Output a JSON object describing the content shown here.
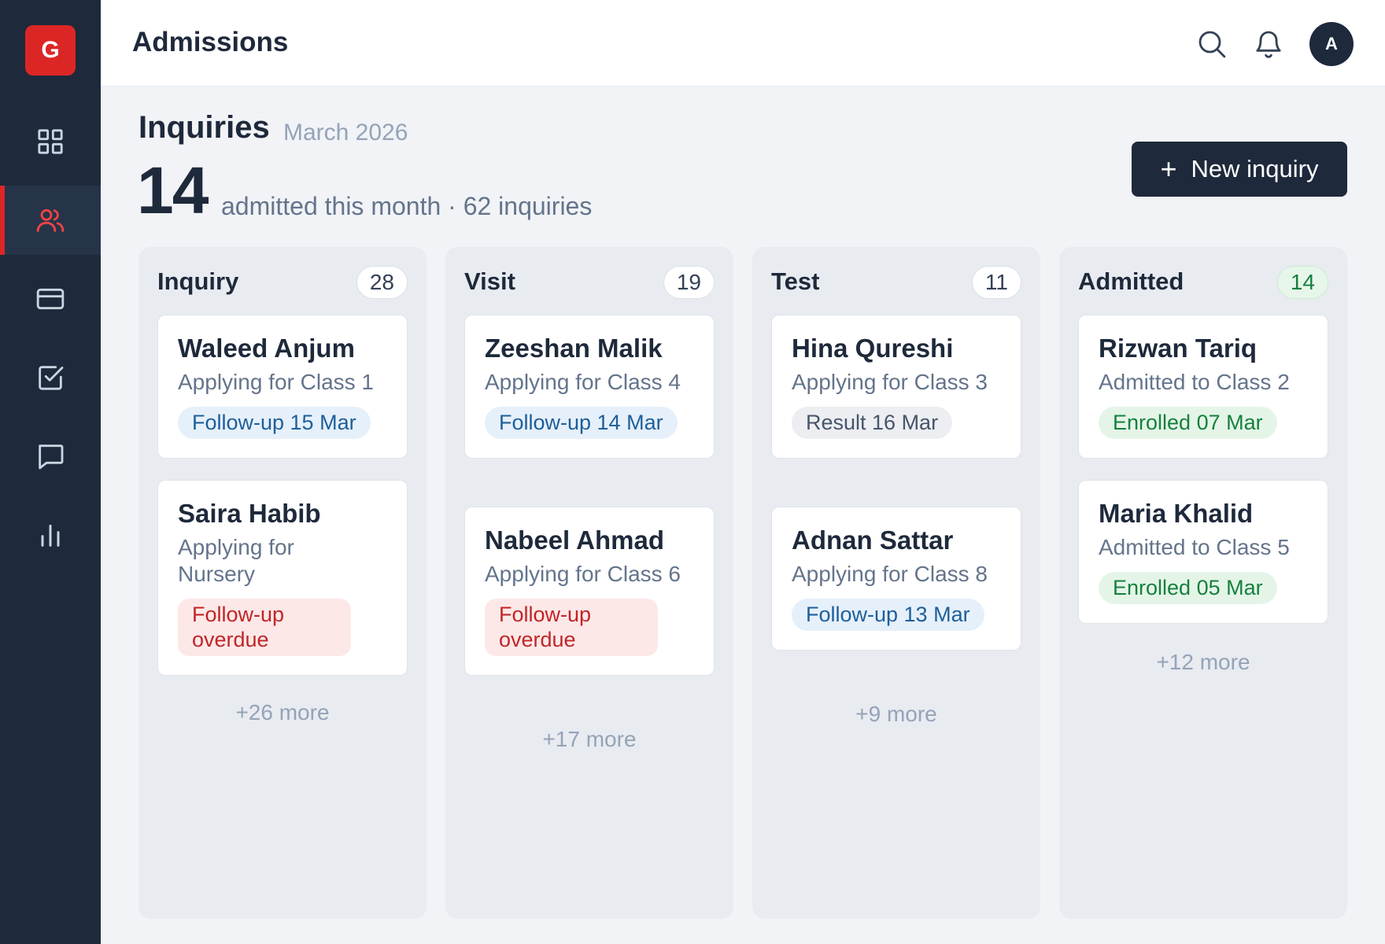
{
  "app": {
    "logo_letter": "G"
  },
  "sidebar": {
    "items": [
      {
        "icon": "grid-icon",
        "label": "Dashboard"
      },
      {
        "icon": "users-icon",
        "label": "Admissions",
        "active": true
      },
      {
        "icon": "card-icon",
        "label": "Fees"
      },
      {
        "icon": "checkbox-icon",
        "label": "Attendance"
      },
      {
        "icon": "chat-icon",
        "label": "Messages"
      },
      {
        "icon": "bar-chart-icon",
        "label": "Reports"
      }
    ]
  },
  "header": {
    "title": "Admissions",
    "avatar_initial": "A"
  },
  "page": {
    "title": "Inquiries",
    "subtitle": "March 2026",
    "admitted_count": "14",
    "summary": "admitted this month · 62 inquiries",
    "new_button": {
      "icon": "+",
      "label": "New inquiry"
    }
  },
  "columns": [
    {
      "title": "Inquiry",
      "count": "28",
      "cards": [
        {
          "name": "Waleed Anjum",
          "desc": "Applying for Class 1",
          "badge": "Follow-up 15 Mar",
          "badge_type": "blue"
        },
        {
          "name": "Saira Habib",
          "desc": "Applying for Nursery",
          "badge": "Follow-up overdue",
          "badge_type": "red"
        }
      ],
      "more": "+26 more"
    },
    {
      "title": "Visit",
      "count": "19",
      "cards": [
        {
          "name": "Zeeshan Malik",
          "desc": "Applying for Class 4",
          "badge": "Follow-up 14 Mar",
          "badge_type": "blue"
        },
        {
          "name": "Nabeel Ahmad",
          "desc": "Applying for Class 6",
          "badge": "Follow-up overdue",
          "badge_type": "red"
        }
      ],
      "more": "+17 more"
    },
    {
      "title": "Test",
      "count": "11",
      "cards": [
        {
          "name": "Hina Qureshi",
          "desc": "Applying for Class 3",
          "badge": "Result 16 Mar",
          "badge_type": "gray"
        },
        {
          "name": "Adnan Sattar",
          "desc": "Applying for Class 8",
          "badge": "Follow-up 13 Mar",
          "badge_type": "blue"
        }
      ],
      "more": "+9 more"
    },
    {
      "title": "Admitted",
      "count": "14",
      "cards": [
        {
          "name": "Rizwan Tariq",
          "desc": "Admitted to Class 2",
          "badge": "Enrolled 07 Mar",
          "badge_type": "green"
        },
        {
          "name": "Maria Khalid",
          "desc": "Admitted to Class 5",
          "badge": "Enrolled 05 Mar",
          "badge_type": "green"
        }
      ],
      "more": "+12 more"
    }
  ],
  "colors": {
    "sidebar_bg": "#1e293b",
    "accent": "#dc2626",
    "primary_button": "#1e293b",
    "badge_blue": "#1d5f9a",
    "badge_red": "#c02626",
    "badge_green": "#16803d"
  }
}
